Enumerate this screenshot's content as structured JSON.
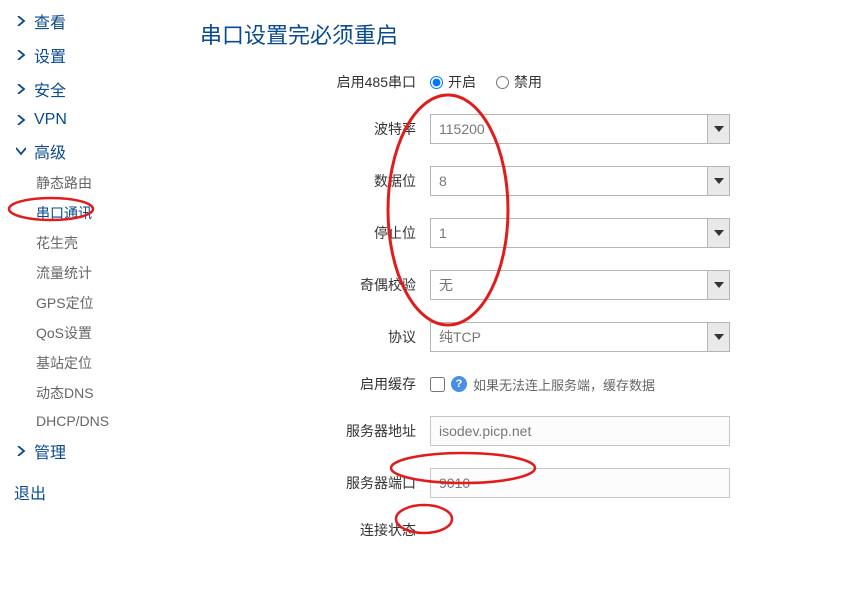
{
  "sidebar": {
    "items": [
      {
        "label": "查看",
        "expanded": false
      },
      {
        "label": "设置",
        "expanded": false
      },
      {
        "label": "安全",
        "expanded": false
      },
      {
        "label": "VPN",
        "expanded": false
      },
      {
        "label": "高级",
        "expanded": true,
        "children": [
          {
            "label": "静态路由"
          },
          {
            "label": "串口通讯",
            "active": true
          },
          {
            "label": "花生壳"
          },
          {
            "label": "流量统计"
          },
          {
            "label": "GPS定位"
          },
          {
            "label": "QoS设置"
          },
          {
            "label": "基站定位"
          },
          {
            "label": "动态DNS"
          },
          {
            "label": "DHCP/DNS"
          }
        ]
      },
      {
        "label": "管理",
        "expanded": false
      }
    ],
    "logout": "退出"
  },
  "main": {
    "title": "串口设置完必须重启",
    "fields": {
      "enable485": {
        "label": "启用485串口",
        "options": {
          "on": "开启",
          "off": "禁用"
        },
        "value": "on"
      },
      "baud": {
        "label": "波特率",
        "value": "115200"
      },
      "databits": {
        "label": "数据位",
        "value": "8"
      },
      "stopbits": {
        "label": "停止位",
        "value": "1"
      },
      "parity": {
        "label": "奇偶校验",
        "value": "无"
      },
      "protocol": {
        "label": "协议",
        "value": "纯TCP"
      },
      "cache": {
        "label": "启用缓存",
        "hint": "如果无法连上服务端，缓存数据",
        "checked": false
      },
      "server_addr": {
        "label": "服务器地址",
        "value": "isodev.picp.net"
      },
      "server_port": {
        "label": "服务器端口",
        "value": "9010"
      },
      "conn_status": {
        "label": "连接状态"
      }
    }
  },
  "colors": {
    "accent": "#0a4b8f",
    "annotation": "#e21b1b"
  }
}
